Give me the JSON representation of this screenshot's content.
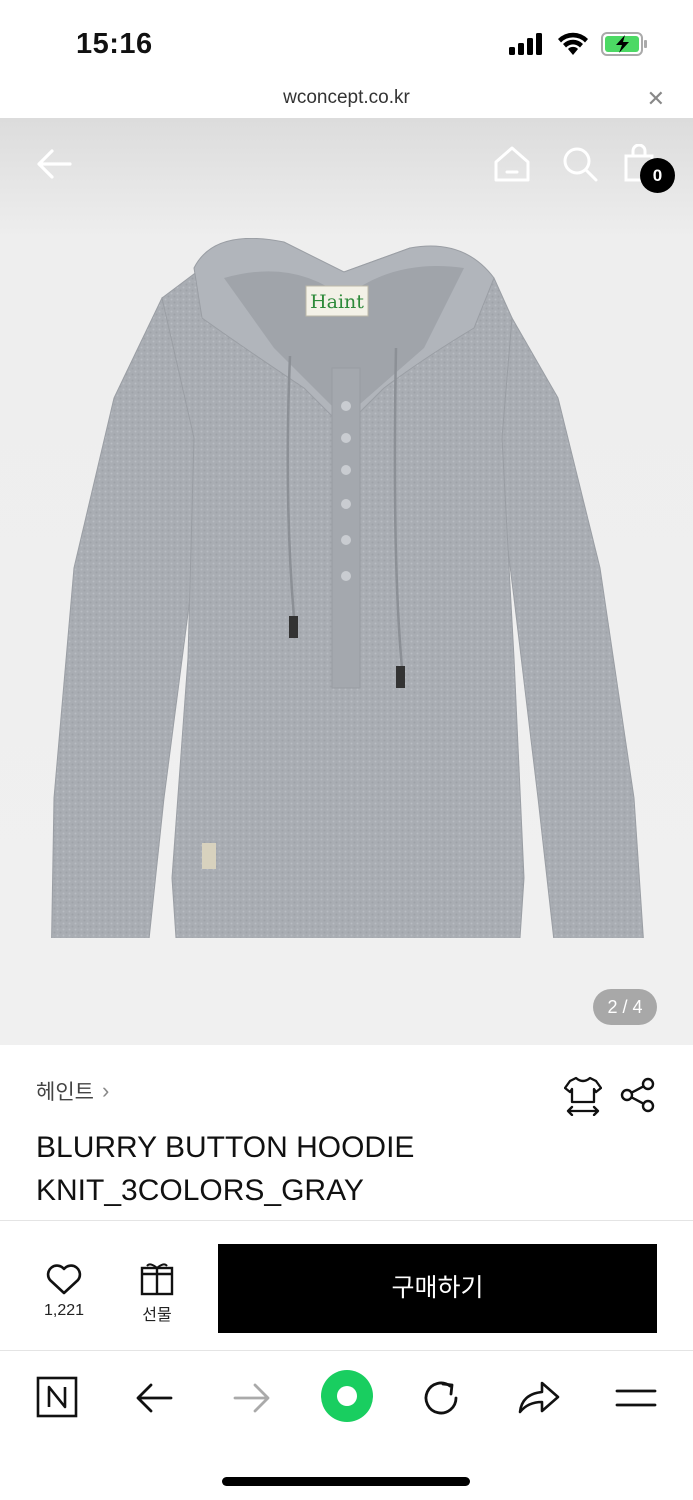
{
  "status_bar": {
    "time": "15:16",
    "icons": [
      "cellular-signal-icon",
      "wifi-icon",
      "battery-charging-icon"
    ],
    "battery_color": "#4cd964"
  },
  "url_bar": {
    "url": "wconcept.co.kr",
    "close_icon": "close-icon"
  },
  "hero": {
    "icons": [
      "back-arrow-icon",
      "home-icon",
      "search-icon",
      "shopping-bag-icon"
    ],
    "bag_count": "0",
    "garment_label": "Haint",
    "image_counter": "2 / 4"
  },
  "product": {
    "brand": "헤인트",
    "brand_chevron": "›",
    "title_line1": "BLURRY BUTTON HOODIE",
    "title_line2": "KNIT_3COLORS_GRAY",
    "icons": [
      "size-guide-icon",
      "share-icon"
    ]
  },
  "purchase_bar": {
    "like_count": "1,221",
    "gift_label": "선물",
    "buy_label": "구매하기",
    "buy_color": "#000000",
    "icons": [
      "heart-icon",
      "gift-icon"
    ]
  },
  "browser_toolbar": {
    "icons": [
      "naver-n-icon",
      "back-icon",
      "forward-icon",
      "green-dot-icon",
      "reload-icon",
      "share-arrow-icon",
      "menu-icon"
    ],
    "accent": "#19ce60"
  }
}
